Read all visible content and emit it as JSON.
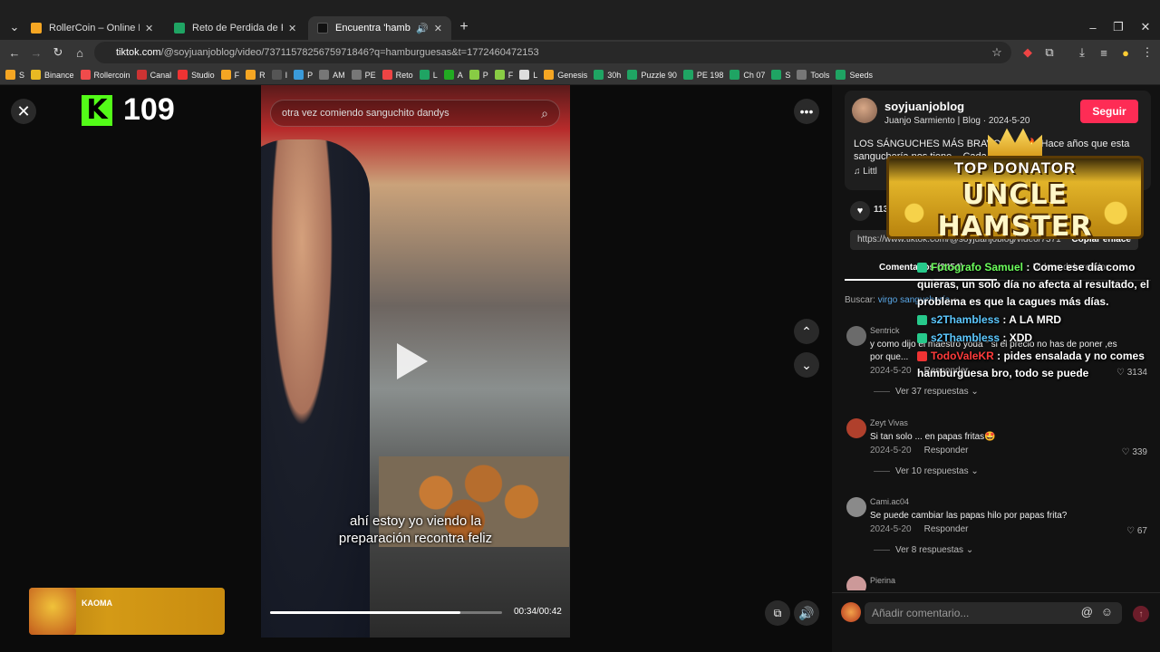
{
  "browser": {
    "tabs": [
      {
        "title": "RollerCoin – Online Bitcoin Mi",
        "color": "#f5a623"
      },
      {
        "title": "Reto de Perdida de Peso - El M",
        "color": "#1fa463"
      },
      {
        "title": "Encuentra 'hamburguesas'",
        "color": "#111111"
      }
    ],
    "url_host": "tiktok.com",
    "url_path": "/@soyjuanjoblog/video/7371157825675971846?q=hamburguesas&t=1772460472153",
    "bookmarks": [
      "S",
      "Binance",
      "Rollercoin",
      "Canal",
      "Studio",
      "F",
      "R",
      "I",
      "P",
      "AM",
      "PE",
      "Reto",
      "L",
      "A",
      "P",
      "F",
      "L",
      "Genesis",
      "30h",
      "Puzzle 90",
      "PE 198",
      "Ch 07",
      "S",
      "Tools",
      "Seeds"
    ]
  },
  "overlay": {
    "kick_count": "109",
    "now_playing": "KAOMA",
    "donor_top": "TOP DONATOR",
    "donor_name": "UNCLE HAMSTER"
  },
  "video": {
    "search_placeholder": "otra vez comiendo sanguchito dandys",
    "caption_line1": "ahí estoy yo viendo la",
    "caption_line2": "preparación recontra feliz",
    "time": "00:34/00:42",
    "progress": 0.82
  },
  "author": {
    "handle": "soyjuanjoblog",
    "subtitle": "Juanjo Sarmiento | Blog · 2024-5-20",
    "follow_label": "Seguir",
    "description": "LOS SÁNGUCHES MÁS BRAVO🔥🔥🔥 Hace años que esta sanguchería nos tiene... Cada v... más",
    "music": "♫ Littl",
    "likes": "113",
    "link": "https://www.tiktok.com/@soyjuanjoblog/video/7371",
    "copy_label": "Copiar enlace"
  },
  "comments_tabs": {
    "comments": "Comentarios (2454)",
    "creator": "Videos del creador"
  },
  "search_line": {
    "label": "Buscar:",
    "query": "virgo sanguchería"
  },
  "comments": [
    {
      "name": "Sentrick",
      "text": "y como dijo el maestro yoda \" si el precio no has de poner ,es por que...",
      "date": "2024-5-20",
      "reply": "Responder",
      "likes": "3134",
      "more": "Ver 37 respuestas ⌄",
      "color": "#6b6b6b"
    },
    {
      "name": "Zeyt Vivas",
      "text": "Si tan solo ... en papas fritas🤩",
      "date": "2024-5-20",
      "reply": "Responder",
      "likes": "339",
      "more": "Ver 10 respuestas ⌄",
      "color": "#b0402c"
    },
    {
      "name": "Cami.ac04",
      "text": "Se puede cambiar las papas hilo por papas frita?",
      "date": "2024-5-20",
      "reply": "Responder",
      "likes": "67",
      "more": "Ver 8 respuestas ⌄",
      "color": "#8a8a8a"
    },
    {
      "name": "Pierina",
      "text": "",
      "date": "",
      "reply": "",
      "likes": "",
      "more": "",
      "color": "#c99"
    }
  ],
  "chat": [
    {
      "user": "Fotografo Samuel",
      "text": ": Come ese día como quieras, un solo día no afecta al resultado, el problema es que la cagues más días.",
      "tone": "blue"
    },
    {
      "user": "s2Thambless",
      "text": ": A LA MRD",
      "tone": "blue"
    },
    {
      "user": "s2Thambless",
      "text": ": XDD",
      "tone": "blue"
    },
    {
      "user": "TodoValeKR",
      "text": ": pides ensalada y no comes hamburguesa bro, todo se puede",
      "tone": "red"
    }
  ],
  "add_comment_placeholder": "Añadir comentario..."
}
